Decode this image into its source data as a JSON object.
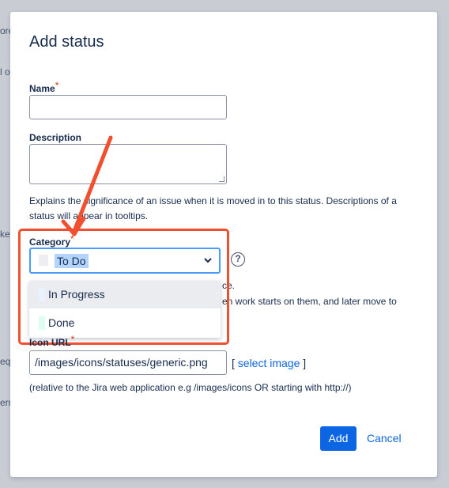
{
  "background": {
    "fragments": [
      "ore",
      "l o",
      "ket",
      "equ",
      "erm"
    ]
  },
  "dialog": {
    "title": "Add status",
    "name": {
      "label": "Name",
      "required_mark": "*",
      "value": ""
    },
    "description": {
      "label": "Description",
      "value": "",
      "help": "Explains the significance of an issue when it is moved in to this status. Descriptions of a status will appear in tooltips."
    },
    "category": {
      "label": "Category",
      "required_mark": "*",
      "selected": "To Do",
      "help_icon": "question-circle-icon",
      "chevron_icon": "chevron-down-icon",
      "options": [
        {
          "label": "In Progress",
          "color": "#e9f2ff"
        },
        {
          "label": "Done",
          "color": "#dcfff1"
        }
      ],
      "partial_help_1": "ce.",
      "partial_help_2": "en work starts on them, and later move to"
    },
    "icon_url": {
      "label": "Icon URL",
      "required_mark": "*",
      "value": "/images/icons/statuses/generic.png",
      "select_link_prefix": "[",
      "select_link": "select image",
      "select_link_suffix": "]",
      "note": "(relative to the Jira web application e.g /images/icons OR starting with http://)"
    },
    "buttons": {
      "add": "Add",
      "cancel": "Cancel"
    }
  },
  "colors": {
    "accent": "#0c66e4",
    "focus": "#4c9aff",
    "annotation": "#f0502f",
    "required": "#de350b"
  }
}
